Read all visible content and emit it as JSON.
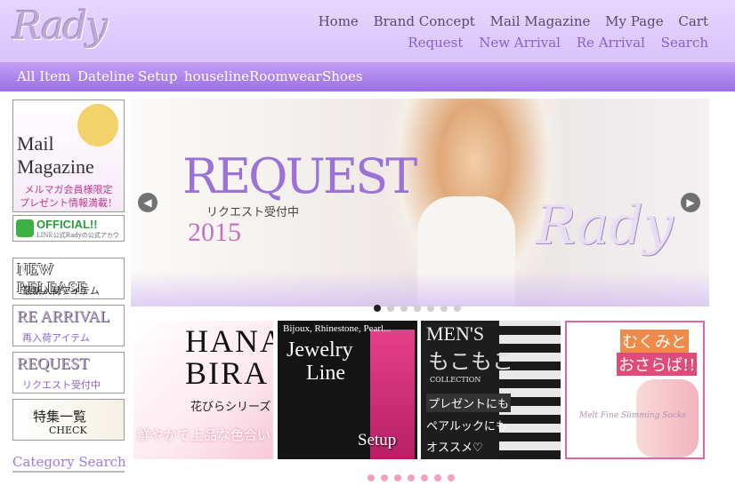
{
  "header": {
    "logo": "Rady",
    "nav_row1": [
      "Home",
      "Brand Concept",
      "Mail Magazine",
      "My Page",
      "Cart"
    ],
    "nav_row2": [
      "Request",
      "New Arrival",
      "Re Arrival",
      "Search"
    ]
  },
  "category_bar": [
    "All Item",
    "Dateline",
    "Setup",
    "houseline",
    "Roomwear",
    "Shoes"
  ],
  "sidebar": {
    "mail_magazine": {
      "line1": "Mail",
      "line2": "Magazine",
      "jp1": "メルマガ会員様限定",
      "jp2": "プレゼント情報満載！"
    },
    "line_official": {
      "title": "OFFICIAL!!",
      "sub": "LINE公式Radyの公式アカウント"
    },
    "new_release": {
      "title": "NEW RELEASE",
      "sub": "最新入荷アイテム"
    },
    "re_arrival": {
      "title": "RE ARRIVAL",
      "sub": "再入荷アイテム"
    },
    "request": {
      "title": "REQUEST",
      "sub": "リクエスト受付中"
    },
    "feature": {
      "title": "特集一覧",
      "sub": "CHECK"
    },
    "category_search": "Category Search"
  },
  "slider": {
    "title": "REQUEST",
    "subtitle": "リクエスト受付中",
    "year": "2015",
    "logo": "Rady",
    "prev_icon": "chevron-left-icon",
    "next_icon": "chevron-right-icon",
    "dots_total": 7,
    "active_dot": 1
  },
  "tiles": {
    "hana": {
      "line1": "HANA",
      "line2": "BIRA",
      "jp": "花びらシリーズ",
      "copy": "鮮やかで上品な色合い"
    },
    "jewelry": {
      "top": "Bijoux, Rhinestone, Pearl...",
      "line1": "Jewelry",
      "line2": "Line",
      "bottom": "Setup"
    },
    "mens": {
      "title": "MEN'S",
      "sub": "もこもこ",
      "collection": "COLLECTION",
      "c1": "プレゼントにも",
      "c2": "ペアルックにも",
      "c3": "オススメ♡"
    },
    "mukumi": {
      "line1": "むくみと",
      "line2": "おさらば!!",
      "sub": "Melt Fine Slimming Socks"
    }
  },
  "tile_dots_total": 7,
  "colors": {
    "header_bg": "#dcc8fc",
    "catbar": "#a77cec",
    "nav_primary": "#5a4a6a",
    "nav_accent": "#8a5fd4",
    "dot_active": "#222222",
    "dot_inactive": "#cfcfcf",
    "tile_dot": "#f3a0c4"
  }
}
